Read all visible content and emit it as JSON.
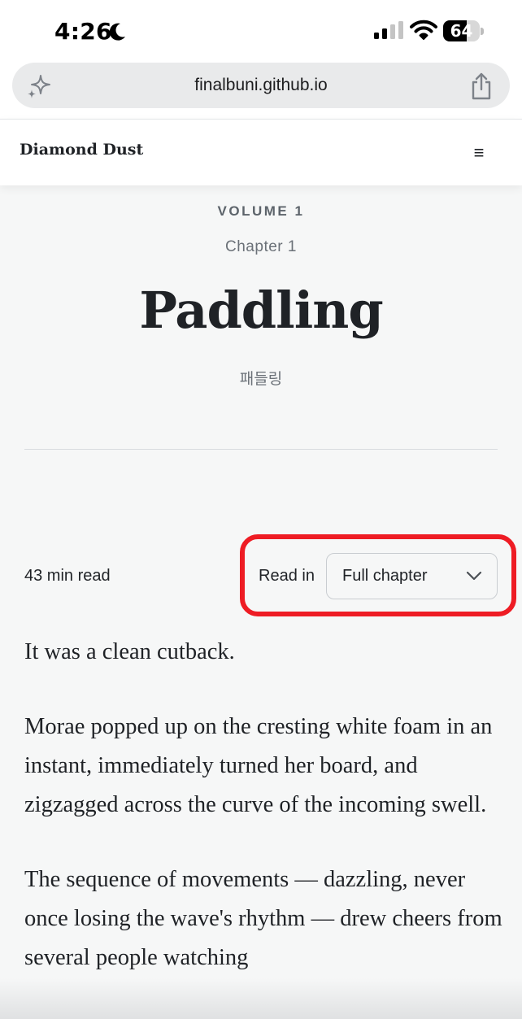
{
  "status_bar": {
    "time": "4:26",
    "battery_level": "64",
    "battery_fraction": 0.64
  },
  "browser": {
    "url": "finalbuni.github.io"
  },
  "site": {
    "title": "Diamond Dust",
    "menu_icon": "≡"
  },
  "chapter": {
    "volume": "VOLUME 1",
    "chapter": "Chapter 1",
    "title": "Paddling",
    "korean_title": "패들링"
  },
  "reading": {
    "read_time": "43 min read",
    "read_in_label": "Read in",
    "mode_selected": "Full chapter"
  },
  "story": {
    "paragraphs": [
      "It was a clean cutback.",
      "Morae popped up on the cresting white foam in an instant, immediately turned her board, and zigzagged across the curve of the incoming swell.",
      "The sequence of movements — dazzling, never once losing the wave's rhythm — drew cheers from several people watching"
    ]
  },
  "colors": {
    "highlight": "#ee1c24",
    "background": "#f6f7f7",
    "text": "#1f2226"
  },
  "icons": {
    "moon": "moon-icon",
    "signal": "cellular-signal-icon",
    "wifi": "wifi-icon",
    "battery": "battery-icon",
    "sparkle": "sparkle-icon",
    "share": "share-icon",
    "menu": "hamburger-menu-icon",
    "chevron": "chevron-down-icon"
  }
}
